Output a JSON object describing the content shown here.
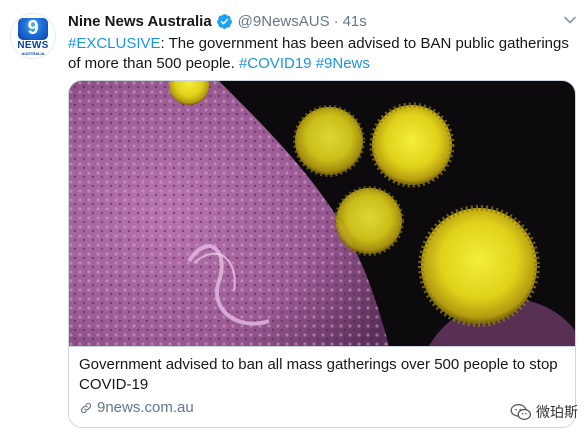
{
  "author": {
    "name": "Nine News Australia",
    "handle": "@9NewsAUS",
    "separator": "·",
    "time": "41s",
    "avatar_logo": {
      "top": "9",
      "middle": "NEWS",
      "bottom": "AUSTRALIA"
    }
  },
  "tweet": {
    "hashtag_1": "#EXCLUSIVE",
    "body": ": The government has been advised to BAN public gatherings of more than 500 people. ",
    "hashtag_2": "#COVID19",
    "hashtag_3": "#9News"
  },
  "card": {
    "title": "Government advised to ban all mass gatherings over 500 people to stop COVID-19",
    "domain": "9news.com.au"
  },
  "watermark": {
    "text": "微珀斯"
  },
  "colors": {
    "link": "#1b95e0",
    "muted": "#657786",
    "border": "#ccd6dd",
    "verified": "#1da1f2"
  },
  "icons": [
    "verified-badge-icon",
    "chevron-down-icon",
    "link-icon",
    "wechat-icon"
  ]
}
